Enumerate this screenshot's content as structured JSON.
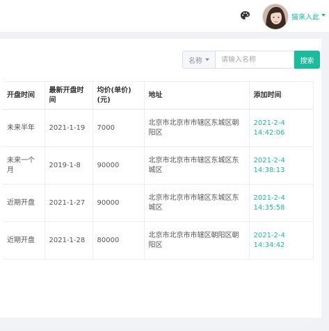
{
  "header": {
    "user_name": "猫来入此",
    "avatar": "avatar-photo",
    "palette": "palette-icon"
  },
  "search": {
    "type_label": "名称",
    "placeholder": "请输入名称",
    "button_label": "搜索"
  },
  "table": {
    "columns": [
      "开盘时间",
      "最新开盘时间",
      "均价(单价)(元)",
      "地址",
      "添加时间"
    ],
    "rows": [
      {
        "open": "未来半年",
        "latest": "2021-1-19",
        "price": "7000",
        "address": "北京市北京市市辖区东城区朝阳区",
        "added": "2021-2-4 14:42:06"
      },
      {
        "open": "未来一个月",
        "latest": "2019-1-8",
        "price": "90000",
        "address": "北京市北京市市辖区东城区东城区",
        "added": "2021-2-4 14:38:13"
      },
      {
        "open": "近期开盘",
        "latest": "2021-1-27",
        "price": "90000",
        "address": "北京市北京市市辖区东城区东城区",
        "added": "2021-2-4 14:35:58"
      },
      {
        "open": "近期开盘",
        "latest": "2021-1-28",
        "price": "80000",
        "address": "北京市北京市市辖区朝阳区朝阳区",
        "added": "2021-2-4 14:34:42"
      }
    ]
  },
  "colors": {
    "accent": "#1abc9c",
    "background": "#f0f2f5"
  }
}
